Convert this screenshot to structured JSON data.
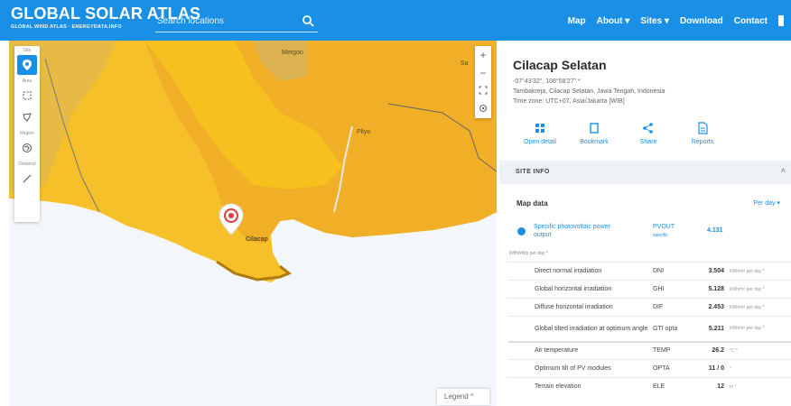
{
  "header": {
    "title": "GLOBAL SOLAR ATLAS",
    "subtitle": "GLOBAL WIND ATLAS  ·  ENERGYDATA.INFO",
    "search_placeholder": "Search locations",
    "nav": [
      "Map",
      "About ▾",
      "Sites ▾",
      "Download",
      "Contact"
    ],
    "accent": "#1a8fe6"
  },
  "map": {
    "tool_labels": {
      "site": "Site",
      "area": "Area",
      "region": "Region",
      "distance": "Distance"
    },
    "labels": {
      "city": "Cilacap",
      "town_nw": "Mergon",
      "town_ne": "Sa",
      "town_mid": "Pliyo"
    },
    "legend": "Legend  ^",
    "colors": {
      "irradiation_low": "#f7c21f",
      "irradiation_high": "#f0a928",
      "sea": "#f3f6fa"
    }
  },
  "panel": {
    "title": "Cilacap Selatan",
    "coords": "-07°43'32\", 108°58'27\" *",
    "address": "Tambakreja, Cilacap Selatan, Jawa Tengah, Indonesia",
    "timezone": "Time zone: UTC+07, Asia/Jakarta [WIB]",
    "actions": [
      "Open detail",
      "Bookmark",
      "Share",
      "Reports"
    ],
    "site_info": "SITE INFO",
    "map_data": "Map data",
    "per_day": "Per day ▾",
    "pv": {
      "name": "Specific photovoltaic power output",
      "abbr": "PVOUT",
      "abbr_sub": "specific",
      "value": "4.131"
    },
    "units_note": "kWh/kWp per day *",
    "rows": [
      {
        "name": "Direct normal irradiation",
        "abbr": "DNI",
        "value": "3.504",
        "unit": "kWh/m² per day *"
      },
      {
        "name": "Global horizontal irradiation",
        "abbr": "GHI",
        "value": "5.128",
        "unit": "kWh/m² per day *"
      },
      {
        "name": "Diffuse horizontal irradiation",
        "abbr": "DIF",
        "value": "2.453",
        "unit": "kWh/m² per day *"
      },
      {
        "name": "Global tilted irradiation at optimum angle",
        "abbr": "GTI opta",
        "value": "5.211",
        "unit": "kWh/m² per day *"
      },
      {
        "name": "Air temperature",
        "abbr": "TEMP",
        "value": "26.2",
        "unit": "°C *"
      },
      {
        "name": "Optimum tilt of PV modules",
        "abbr": "OPTA",
        "value": "11 / 0",
        "unit": "°"
      },
      {
        "name": "Terrain elevation",
        "abbr": "ELE",
        "value": "12",
        "unit": "m *"
      }
    ]
  }
}
